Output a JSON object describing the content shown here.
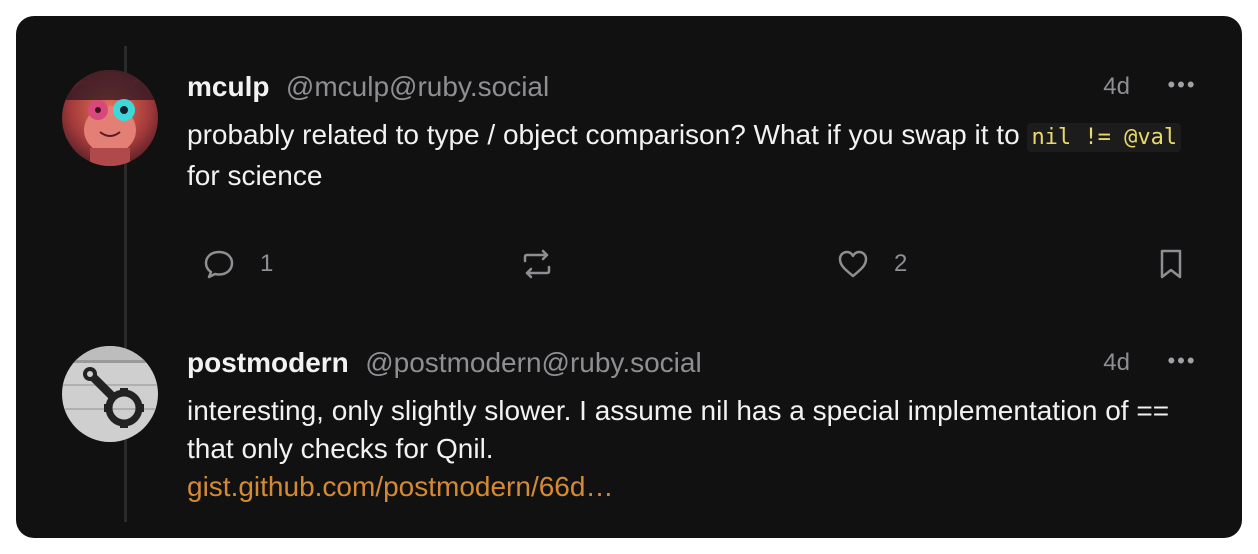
{
  "posts": [
    {
      "display_name": "mculp",
      "handle": "@mculp@ruby.social",
      "time": "4d",
      "body_before": "probably related to type / object comparison? What if you swap it to ",
      "code": "nil != @val",
      "body_after": " for science",
      "replies": "1",
      "likes": "2",
      "icons": {
        "reply": "speech-bubble-icon",
        "boost": "repeat-icon",
        "like": "heart-icon",
        "bookmark": "bookmark-icon",
        "more": "ellipsis-icon"
      }
    },
    {
      "display_name": "postmodern",
      "handle": "@postmodern@ruby.social",
      "time": "4d",
      "body": "interesting, only slightly slower. I assume nil has a special implementation of == that only checks for Qnil.",
      "link": "gist.github.com/postmodern/66d…",
      "icons": {
        "more": "ellipsis-icon"
      }
    }
  ],
  "colors": {
    "card_bg": "#111111",
    "text": "#f2f2f2",
    "muted": "#8e8e93",
    "code": "#e9d96c",
    "link": "#d48a35"
  }
}
